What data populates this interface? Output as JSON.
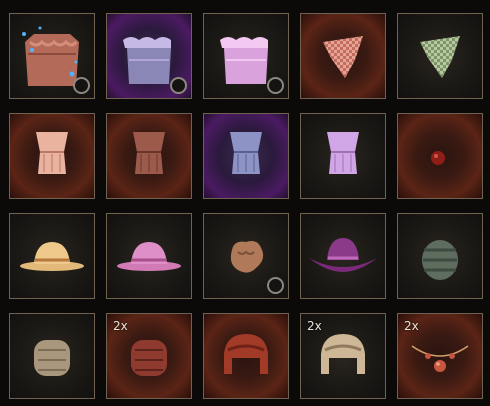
{
  "inventory": {
    "slots": [
      {
        "item": "blue-sparkle-bodice-icon",
        "bg": "dark",
        "badge": true,
        "qty": ""
      },
      {
        "item": "lavender-ruffle-top-icon",
        "bg": "purple",
        "badge": true,
        "qty": ""
      },
      {
        "item": "pink-ruffle-top-icon",
        "bg": "dark",
        "badge": true,
        "qty": ""
      },
      {
        "item": "red-checkered-bandana-icon",
        "bg": "red",
        "badge": false,
        "qty": ""
      },
      {
        "item": "green-checkered-bandana-icon",
        "bg": "dark",
        "badge": false,
        "qty": ""
      },
      {
        "item": "peach-corset-top-icon",
        "bg": "red",
        "badge": false,
        "qty": ""
      },
      {
        "item": "brown-corset-top-icon",
        "bg": "red",
        "badge": false,
        "qty": ""
      },
      {
        "item": "blue-corset-top-icon",
        "bg": "purple",
        "badge": false,
        "qty": ""
      },
      {
        "item": "lilac-corset-top-icon",
        "bg": "dark",
        "badge": false,
        "qty": ""
      },
      {
        "item": "red-orb-icon",
        "bg": "red",
        "badge": false,
        "qty": ""
      },
      {
        "item": "straw-hat-icon",
        "bg": "dark",
        "badge": false,
        "qty": ""
      },
      {
        "item": "pink-hat-icon",
        "bg": "dark",
        "badge": false,
        "qty": ""
      },
      {
        "item": "brown-fur-clump-icon",
        "bg": "dark",
        "badge": true,
        "qty": ""
      },
      {
        "item": "purple-cowboy-hat-icon",
        "bg": "dark",
        "badge": false,
        "qty": ""
      },
      {
        "item": "green-rolled-cloth-icon",
        "bg": "dark",
        "badge": false,
        "qty": ""
      },
      {
        "item": "tan-leather-roll-icon",
        "bg": "dark",
        "badge": false,
        "qty": ""
      },
      {
        "item": "red-leather-roll-icon",
        "bg": "red",
        "badge": false,
        "qty": "2x"
      },
      {
        "item": "red-aviator-cap-icon",
        "bg": "red",
        "badge": false,
        "qty": ""
      },
      {
        "item": "tan-aviator-cap-icon",
        "bg": "dark",
        "badge": false,
        "qty": "2x"
      },
      {
        "item": "red-gem-necklace-icon",
        "bg": "red",
        "badge": false,
        "qty": "2x"
      }
    ]
  },
  "colors": {
    "border": "#6f6251",
    "rarity_purple": "#4b1a62",
    "rarity_red": "#5b2416"
  }
}
